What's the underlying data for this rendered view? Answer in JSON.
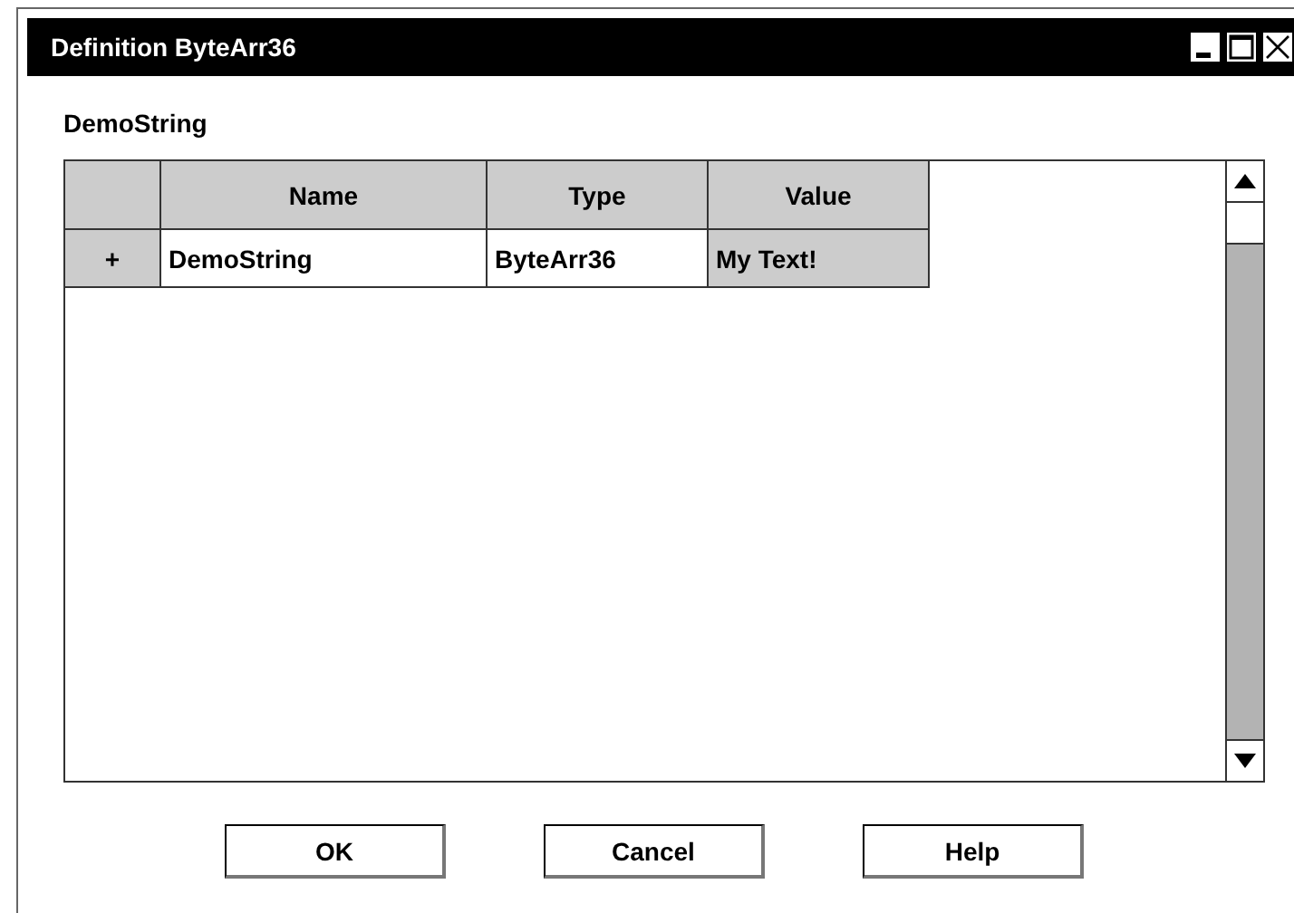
{
  "window": {
    "title": "Definition ByteArr36"
  },
  "label": "DemoString",
  "table": {
    "columns": [
      "Name",
      "Type",
      "Value"
    ],
    "rows": [
      {
        "marker": "+",
        "cells": [
          "DemoString",
          "ByteArr36",
          "My Text!"
        ]
      }
    ]
  },
  "buttons": [
    "OK",
    "Cancel",
    "Help"
  ]
}
